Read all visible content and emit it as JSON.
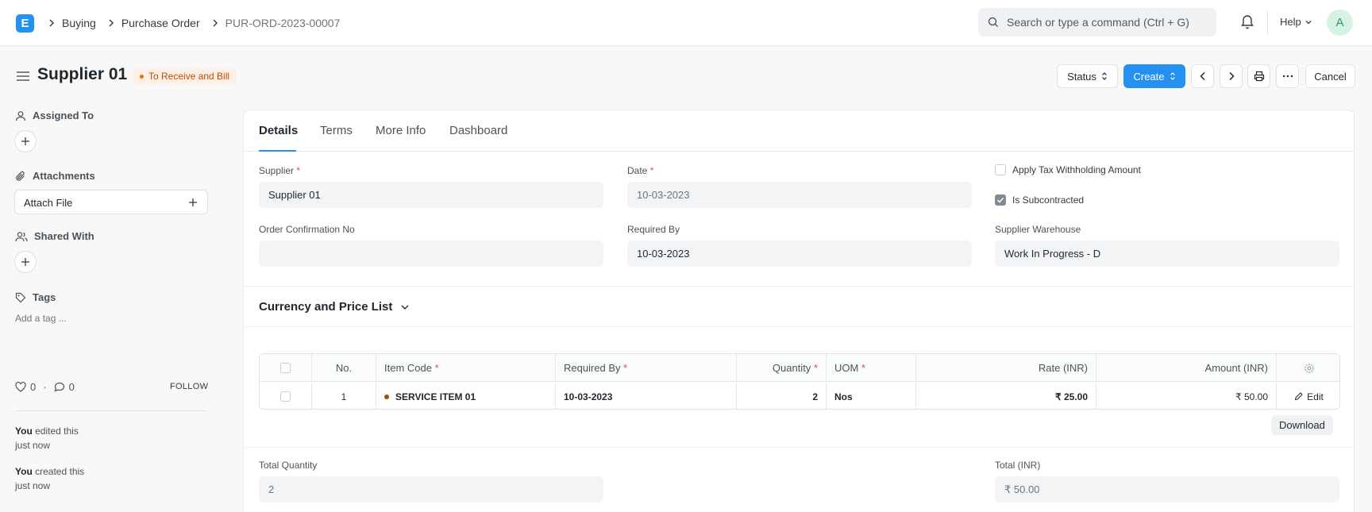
{
  "navbar": {
    "logo": "E",
    "breadcrumbs": [
      "Buying",
      "Purchase Order",
      "PUR-ORD-2023-00007"
    ],
    "search_placeholder": "Search or type a command (Ctrl + G)",
    "help_label": "Help",
    "avatar_initial": "A"
  },
  "page": {
    "title": "Supplier 01",
    "status": "To Receive and Bill",
    "status_color": "#e8710b",
    "buttons": {
      "status": "Status",
      "create": "Create",
      "cancel": "Cancel"
    }
  },
  "sidebar": {
    "assigned_to": "Assigned To",
    "attachments": "Attachments",
    "attach_file": "Attach File",
    "shared_with": "Shared With",
    "tags": "Tags",
    "add_tag": "Add a tag ...",
    "likes": "0",
    "comments": "0",
    "follow": "FOLLOW",
    "activity": [
      {
        "who": "You",
        "action": "edited this",
        "when": "just now"
      },
      {
        "who": "You",
        "action": "created this",
        "when": "just now"
      }
    ]
  },
  "tabs": [
    "Details",
    "Terms",
    "More Info",
    "Dashboard"
  ],
  "form": {
    "supplier_label": "Supplier",
    "supplier": "Supplier 01",
    "date_label": "Date",
    "date": "10-03-2023",
    "apply_tax_label": "Apply Tax Withholding Amount",
    "apply_tax_checked": false,
    "subcontracted_label": "Is Subcontracted",
    "subcontracted_checked": true,
    "order_confirmation_label": "Order Confirmation No",
    "order_confirmation": "",
    "required_by_label": "Required By",
    "required_by": "10-03-2023",
    "supplier_warehouse_label": "Supplier Warehouse",
    "supplier_warehouse": "Work In Progress - D",
    "currency_section": "Currency and Price List"
  },
  "items_table": {
    "columns": [
      "No.",
      "Item Code",
      "Required By",
      "Quantity",
      "UOM",
      "Rate (INR)",
      "Amount (INR)"
    ],
    "rows": [
      {
        "no": "1",
        "item_code": "SERVICE ITEM 01",
        "required_by": "10-03-2023",
        "quantity": "2",
        "uom": "Nos",
        "rate": "₹ 25.00",
        "amount": "₹ 50.00",
        "edit": "Edit"
      }
    ],
    "download": "Download"
  },
  "totals": {
    "total_quantity_label": "Total Quantity",
    "total_quantity": "2",
    "total_label": "Total (INR)",
    "total": "₹ 50.00"
  }
}
